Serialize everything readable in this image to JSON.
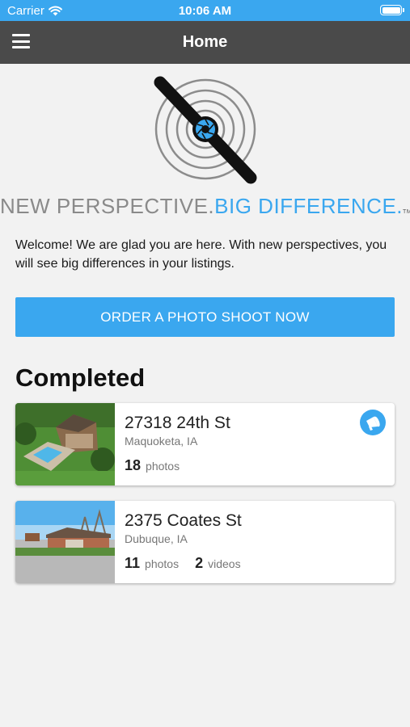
{
  "status_bar": {
    "carrier": "Carrier",
    "time": "10:06 AM"
  },
  "nav": {
    "title": "Home"
  },
  "brand": {
    "tagline_part1": "NEW PERSPECTIVE.",
    "tagline_part2": "BIG DIFFERENCE.",
    "tm": "TM"
  },
  "welcome": "Welcome! We are glad you are here. With new perspectives, you will see big differences in your listings.",
  "order_button": "ORDER A PHOTO SHOOT NOW",
  "completed_heading": "Completed",
  "listings": [
    {
      "address": "27318 24th St",
      "city": "Maquoketa, IA",
      "photos": "18",
      "photos_label": "photos"
    },
    {
      "address": "2375 Coates St",
      "city": "Dubuque, IA",
      "photos": "11",
      "photos_label": "photos",
      "videos": "2",
      "videos_label": "videos"
    }
  ],
  "colors": {
    "accent": "#3aa7ef",
    "nav": "#4a4a4a",
    "background": "#f2f2f2"
  },
  "icons": [
    "wifi-icon",
    "battery-icon",
    "hamburger-menu-icon",
    "drone-camera-logo",
    "megaphone-icon"
  ]
}
